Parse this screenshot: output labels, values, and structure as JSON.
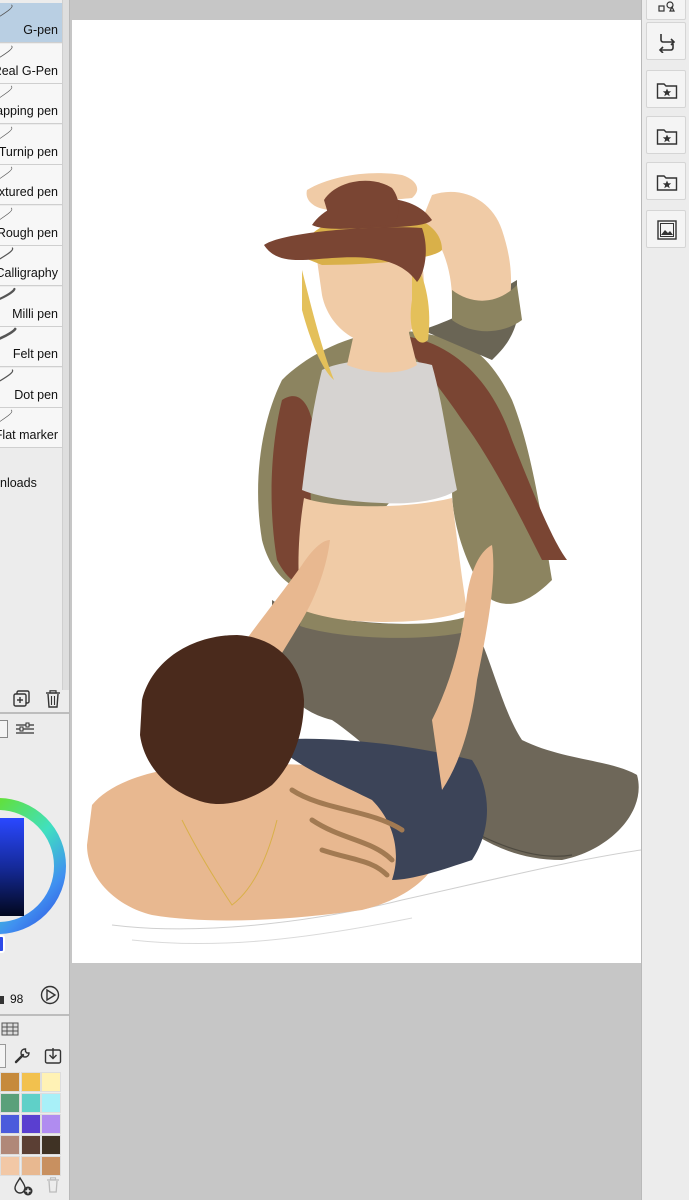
{
  "brushes": [
    {
      "label": "G-pen",
      "selected": true
    },
    {
      "label": "Real G-Pen",
      "selected": false
    },
    {
      "label": "apping pen",
      "selected": false
    },
    {
      "label": "Turnip pen",
      "selected": false
    },
    {
      "label": "xtured pen",
      "selected": false
    },
    {
      "label": "Rough pen",
      "selected": false
    },
    {
      "label": "Calligraphy",
      "selected": false
    },
    {
      "label": "Milli pen",
      "selected": false
    },
    {
      "label": "Felt pen",
      "selected": false
    },
    {
      "label": "Dot pen",
      "selected": false
    },
    {
      "label": "Flat marker",
      "selected": false
    }
  ],
  "downloads_label": "nloads",
  "color_panel": {
    "opacity_value": "98",
    "current_color": "#0b1e6a"
  },
  "swatches": [
    "#c68a3c",
    "#f2c14e",
    "#fff2b5",
    "#5aa07a",
    "#5fd0c8",
    "#a8f0f8",
    "#4b5bdc",
    "#5a3fd0",
    "#b08cf0",
    "#b08878",
    "#5b3f34",
    "#3f3224",
    "#f2c8a6",
    "#e8b890",
    "#c89060"
  ],
  "icons": {
    "add_layer": "add-brush-icon",
    "delete": "trash-icon",
    "wrench": "wrench-icon",
    "download": "download-icon",
    "swap": "swap-icon",
    "favorite_folder": "star-folder-icon",
    "image": "image-icon"
  }
}
